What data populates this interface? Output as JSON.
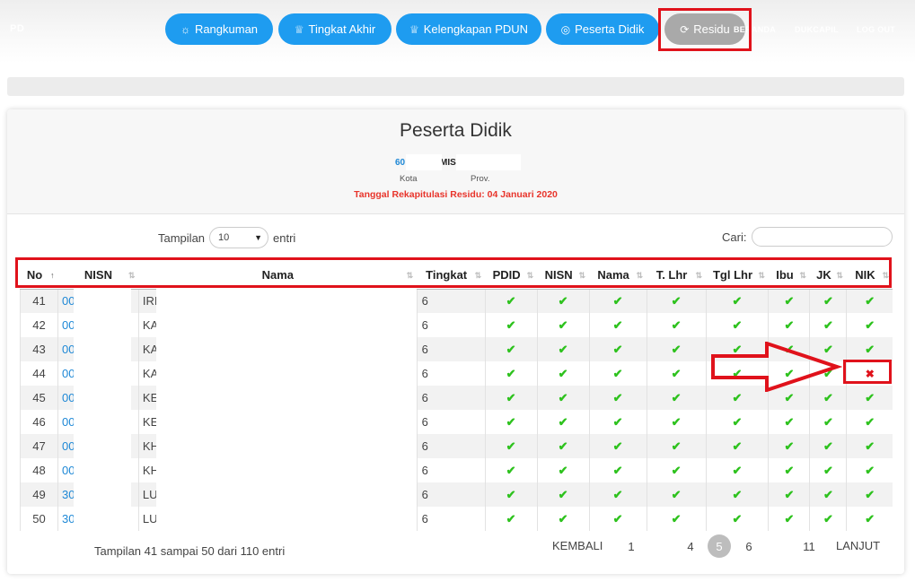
{
  "brand": "PD",
  "nav": [
    {
      "label": "Rangkuman",
      "icon": "lightbulb-icon",
      "glyph": "☼"
    },
    {
      "label": "Tingkat Akhir",
      "icon": "trophy-icon",
      "glyph": "♕"
    },
    {
      "label": "Kelengkapan PDUN",
      "icon": "trophy-icon",
      "glyph": "♕"
    },
    {
      "label": "Peserta Didik",
      "icon": "user-circle-icon",
      "glyph": "◎"
    },
    {
      "label": "Residu",
      "icon": "refresh-icon",
      "glyph": "⟳"
    }
  ],
  "links": [
    "BERANDA",
    "DUKCAPIL",
    "LOG OUT"
  ],
  "card": {
    "title": "Peserta Didik",
    "school_id": "60",
    "school_name": "MIS",
    "city": "Kota",
    "province": "Prov.",
    "recap": "Tanggal Rekapitulasi Residu: 04 Januari 2020"
  },
  "length": {
    "prefix": "Tampilan",
    "value": "10",
    "suffix": "entri"
  },
  "search": {
    "label": "Cari:"
  },
  "columns": [
    "No",
    "NISN",
    "Nama",
    "Tingkat",
    "PDID",
    "NISN",
    "Nama",
    "T. Lhr",
    "Tgl Lhr",
    "Ibu",
    "JK",
    "NIK"
  ],
  "rows": [
    {
      "no": "41",
      "nisn": "00",
      "nama": "IRI",
      "tingkat": "6",
      "checks": [
        1,
        1,
        1,
        1,
        1,
        1,
        1,
        1
      ]
    },
    {
      "no": "42",
      "nisn": "00",
      "nama": "KA",
      "tingkat": "6",
      "checks": [
        1,
        1,
        1,
        1,
        1,
        1,
        1,
        1
      ]
    },
    {
      "no": "43",
      "nisn": "00",
      "nama": "KA",
      "tingkat": "6",
      "checks": [
        1,
        1,
        1,
        1,
        1,
        1,
        1,
        1
      ]
    },
    {
      "no": "44",
      "nisn": "00",
      "nama": "KA",
      "tingkat": "6",
      "checks": [
        1,
        1,
        1,
        1,
        1,
        1,
        1,
        0
      ]
    },
    {
      "no": "45",
      "nisn": "00",
      "nama": "KE",
      "tingkat": "6",
      "checks": [
        1,
        1,
        1,
        1,
        1,
        1,
        1,
        1
      ]
    },
    {
      "no": "46",
      "nisn": "00",
      "nama": "KE",
      "tingkat": "6",
      "checks": [
        1,
        1,
        1,
        1,
        1,
        1,
        1,
        1
      ]
    },
    {
      "no": "47",
      "nisn": "00",
      "nama": "KH",
      "tingkat": "6",
      "checks": [
        1,
        1,
        1,
        1,
        1,
        1,
        1,
        1
      ]
    },
    {
      "no": "48",
      "nisn": "00",
      "nama": "KH",
      "tingkat": "6",
      "checks": [
        1,
        1,
        1,
        1,
        1,
        1,
        1,
        1
      ]
    },
    {
      "no": "49",
      "nisn": "30",
      "nama": "LU",
      "tingkat": "6",
      "checks": [
        1,
        1,
        1,
        1,
        1,
        1,
        1,
        1
      ]
    },
    {
      "no": "50",
      "nisn": "30",
      "nama": "LU",
      "tingkat": "6",
      "checks": [
        1,
        1,
        1,
        1,
        1,
        1,
        1,
        1
      ]
    }
  ],
  "info": "Tampilan 41 sampai 50 dari 110 entri",
  "pager": {
    "prev": "KEMBALI",
    "pages": [
      "1",
      "4",
      "5",
      "6",
      "11"
    ],
    "current": "5",
    "next": "LANJUT"
  },
  "colors": {
    "accent": "#1e9cf0",
    "highlight": "#e0121b",
    "ok": "#2ec21e"
  }
}
